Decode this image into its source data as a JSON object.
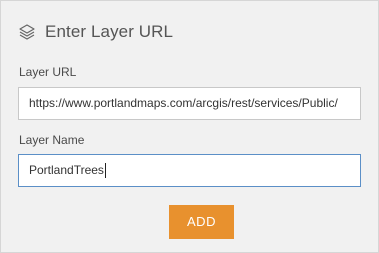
{
  "dialog": {
    "title": "Enter Layer URL",
    "icon": "layers-icon"
  },
  "form": {
    "layer_url": {
      "label": "Layer URL",
      "value": "https://www.portlandmaps.com/arcgis/rest/services/Public/"
    },
    "layer_name": {
      "label": "Layer Name",
      "value": "PortlandTrees"
    },
    "add_button_label": "ADD"
  },
  "colors": {
    "accent": "#e8912e",
    "panel_background": "#f1f1f1",
    "focus_border": "#5b8fc7"
  }
}
